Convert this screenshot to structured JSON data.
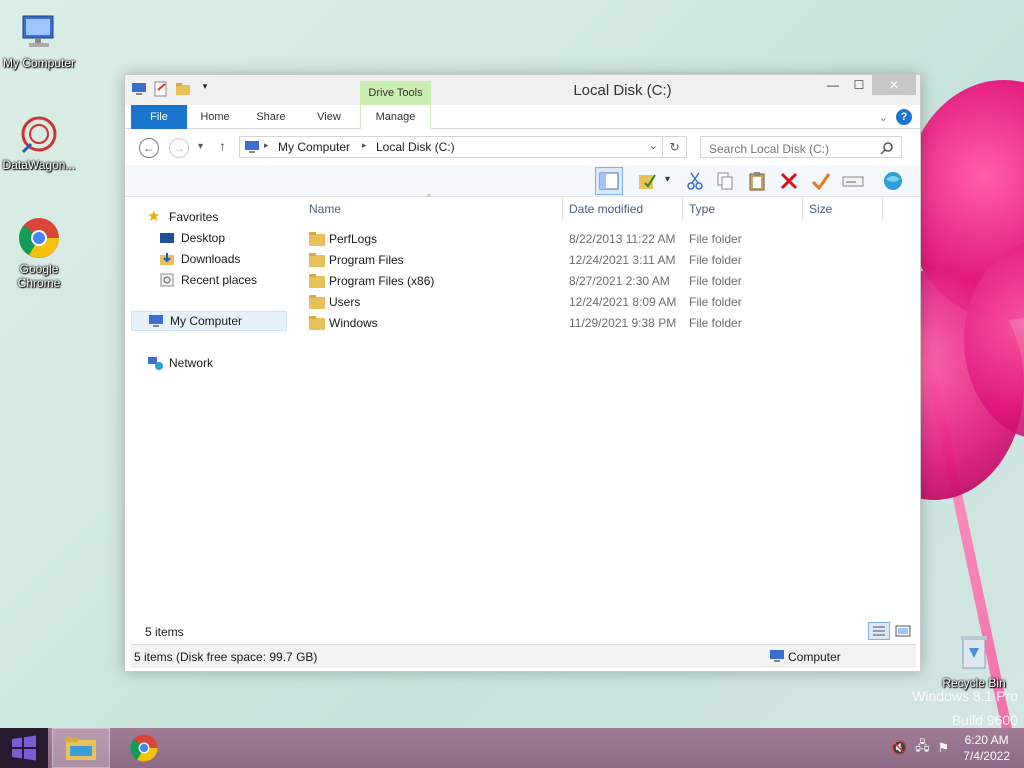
{
  "desktop": {
    "icons": [
      {
        "label": "My Computer"
      },
      {
        "label": "DataWagon..."
      },
      {
        "label": "Google Chrome"
      },
      {
        "label": "Recycle Bin"
      }
    ],
    "watermark_line1": "Windows 8.1 Pro",
    "watermark_line2": "Build 9600"
  },
  "window": {
    "title": "Local Disk (C:)",
    "contextual_tab_group": "Drive Tools",
    "ribbon_tabs": [
      "File",
      "Home",
      "Share",
      "View",
      "Manage"
    ],
    "address": {
      "segments": [
        "My Computer",
        "Local Disk (C:)"
      ]
    },
    "search_placeholder": "Search Local Disk (C:)",
    "navpane": {
      "favorites": "Favorites",
      "favorite_items": [
        "Desktop",
        "Downloads",
        "Recent places"
      ],
      "computer": "My Computer",
      "network": "Network"
    },
    "columns": [
      "Name",
      "Date modified",
      "Type",
      "Size"
    ],
    "files": [
      {
        "name": "PerfLogs",
        "date": "8/22/2013 11:22 AM",
        "type": "File folder"
      },
      {
        "name": "Program Files",
        "date": "12/24/2021 3:11 AM",
        "type": "File folder"
      },
      {
        "name": "Program Files (x86)",
        "date": "8/27/2021 2:30 AM",
        "type": "File folder"
      },
      {
        "name": "Users",
        "date": "12/24/2021 8:09 AM",
        "type": "File folder"
      },
      {
        "name": "Windows",
        "date": "11/29/2021 9:38 PM",
        "type": "File folder"
      }
    ],
    "item_count": "5 items",
    "status_left": "5 items (Disk free space: 99.7 GB)",
    "status_right": "Computer"
  },
  "taskbar": {
    "time": "6:20 AM",
    "date": "7/4/2022"
  },
  "colors": {
    "accent": "#1a75cf",
    "drive_tools": "#c9eeb0",
    "taskbar": "#8c6b86",
    "folder": "#e8c15a"
  }
}
